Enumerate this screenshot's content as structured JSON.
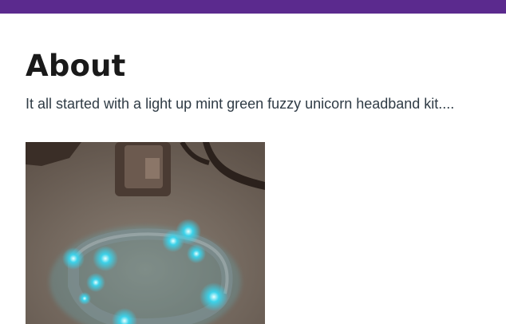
{
  "header": {
    "bar_color": "#5b2a8e"
  },
  "page": {
    "title": "About",
    "intro": "It all started with a light up mint green fuzzy unicorn headband kit...."
  },
  "photo": {
    "subject": "light-up unicorn headband photo",
    "glow_color": "#2fd4ec"
  }
}
